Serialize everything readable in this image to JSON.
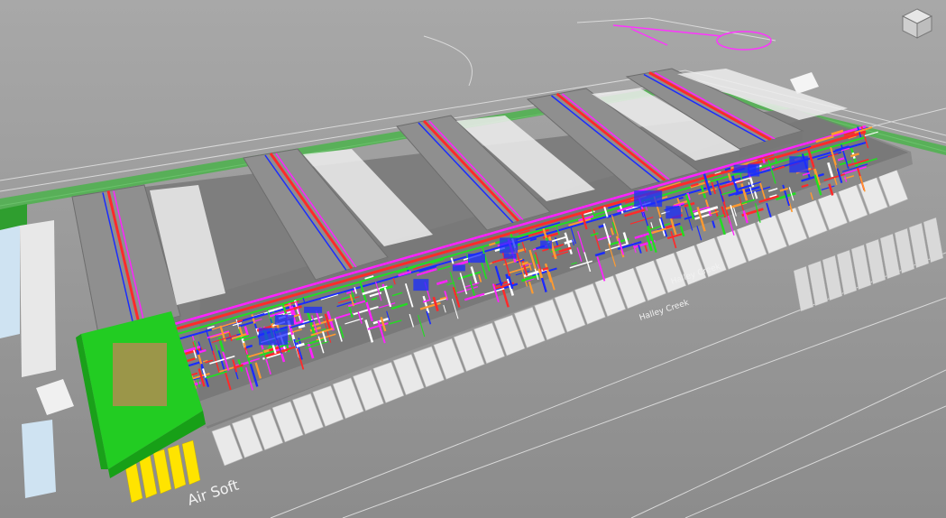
{
  "view": {
    "background": "#9b9b9b",
    "navigation_icon": "viewcube-icon"
  },
  "labels": {
    "road_south": "Air Soft",
    "road_southeast": "Halley Creek",
    "road_mid": "Halley Creek"
  },
  "colors": {
    "building_green": "#22cc22",
    "wall_gray": "#8a8a8a",
    "duct_red": "#ff2a2a",
    "duct_magenta": "#ff22ff",
    "duct_blue": "#1a2cff",
    "duct_green": "#22dd22",
    "duct_orange": "#ff9a30",
    "parking": "#e9e9e9",
    "yellow_bay": "#ffe400"
  }
}
